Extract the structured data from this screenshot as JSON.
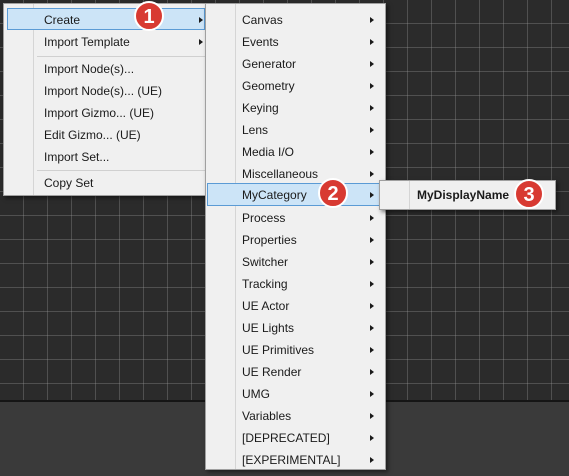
{
  "menu1": {
    "items": [
      {
        "label": "Create"
      },
      {
        "label": "Import Template"
      },
      {
        "label": "Import Node(s)..."
      },
      {
        "label": "Import Node(s)... (UE)"
      },
      {
        "label": "Import Gizmo... (UE)"
      },
      {
        "label": "Edit Gizmo... (UE)"
      },
      {
        "label": "Import Set..."
      },
      {
        "label": "Copy Set"
      }
    ]
  },
  "menu2": {
    "items": [
      {
        "label": "Canvas"
      },
      {
        "label": "Events"
      },
      {
        "label": "Generator"
      },
      {
        "label": "Geometry"
      },
      {
        "label": "Keying"
      },
      {
        "label": "Lens"
      },
      {
        "label": "Media I/O"
      },
      {
        "label": "Miscellaneous"
      },
      {
        "label": "MyCategory"
      },
      {
        "label": "Process"
      },
      {
        "label": "Properties"
      },
      {
        "label": "Switcher"
      },
      {
        "label": "Tracking"
      },
      {
        "label": "UE Actor"
      },
      {
        "label": "UE Lights"
      },
      {
        "label": "UE Primitives"
      },
      {
        "label": "UE Render"
      },
      {
        "label": "UMG"
      },
      {
        "label": "Variables"
      },
      {
        "label": "[DEPRECATED]"
      },
      {
        "label": "[EXPERIMENTAL]"
      }
    ]
  },
  "menu3": {
    "items": [
      {
        "label": "MyDisplayName"
      }
    ]
  },
  "badges": [
    "1",
    "2",
    "3"
  ],
  "colors": {
    "highlight_bg": "#cce4f7",
    "highlight_border": "#5b9bd5",
    "badge": "#d83a32"
  }
}
